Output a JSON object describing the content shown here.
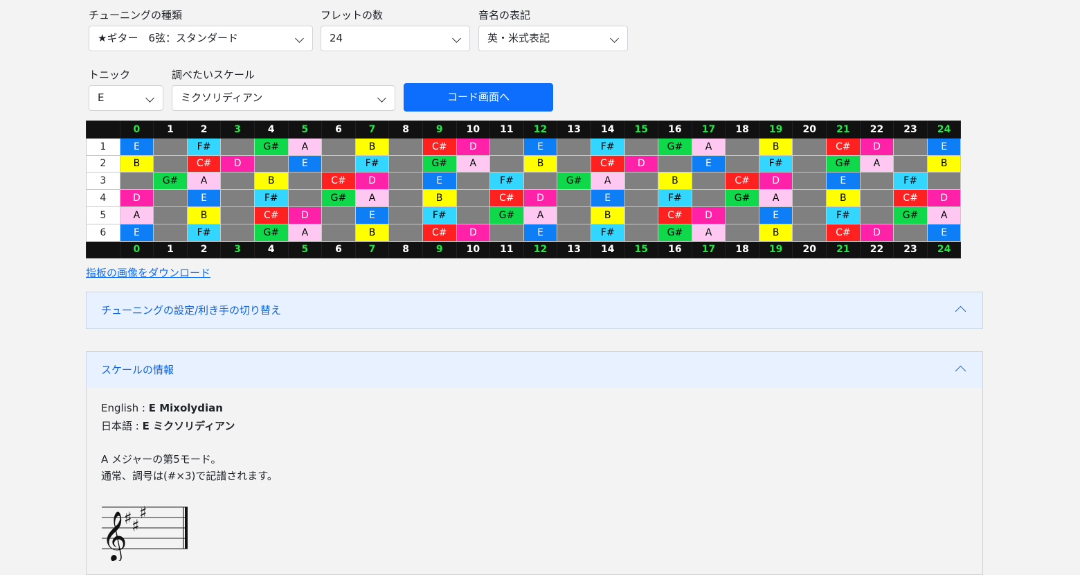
{
  "controls": {
    "tuning_label": "チューニングの種類",
    "tuning_value": "★ギター　6弦：スタンダード",
    "frets_label": "フレットの数",
    "frets_value": "24",
    "notation_label": "音名の表記",
    "notation_value": "英・米式表記",
    "tonic_label": "トニック",
    "tonic_value": "E",
    "scale_label": "調べたいスケール",
    "scale_value": "ミクソリディアン",
    "chord_button": "コード画面へ"
  },
  "fretboard": {
    "fret_numbers": [
      "0",
      "1",
      "2",
      "3",
      "4",
      "5",
      "6",
      "7",
      "8",
      "9",
      "10",
      "11",
      "12",
      "13",
      "14",
      "15",
      "16",
      "17",
      "18",
      "19",
      "20",
      "21",
      "22",
      "23",
      "24"
    ],
    "highlight_frets": [
      "0",
      "3",
      "5",
      "7",
      "9",
      "12",
      "15",
      "17",
      "19",
      "21",
      "24"
    ],
    "strings": [
      {
        "label": "1",
        "notes": [
          "E",
          "",
          "F#",
          "",
          "G#",
          "A",
          "",
          "B",
          "",
          "C#",
          "D",
          "",
          "E",
          "",
          "F#",
          "",
          "G#",
          "A",
          "",
          "B",
          "",
          "C#",
          "D",
          "",
          "E"
        ]
      },
      {
        "label": "2",
        "notes": [
          "B",
          "",
          "C#",
          "D",
          "",
          "E",
          "",
          "F#",
          "",
          "G#",
          "A",
          "",
          "B",
          "",
          "C#",
          "D",
          "",
          "E",
          "",
          "F#",
          "",
          "G#",
          "A",
          "",
          "B"
        ]
      },
      {
        "label": "3",
        "notes": [
          "",
          "G#",
          "A",
          "",
          "B",
          "",
          "C#",
          "D",
          "",
          "E",
          "",
          "F#",
          "",
          "G#",
          "A",
          "",
          "B",
          "",
          "C#",
          "D",
          "",
          "E",
          "",
          "F#",
          ""
        ]
      },
      {
        "label": "4",
        "notes": [
          "D",
          "",
          "E",
          "",
          "F#",
          "",
          "G#",
          "A",
          "",
          "B",
          "",
          "C#",
          "D",
          "",
          "E",
          "",
          "F#",
          "",
          "G#",
          "A",
          "",
          "B",
          "",
          "C#",
          "D"
        ]
      },
      {
        "label": "5",
        "notes": [
          "A",
          "",
          "B",
          "",
          "C#",
          "D",
          "",
          "E",
          "",
          "F#",
          "",
          "G#",
          "A",
          "",
          "B",
          "",
          "C#",
          "D",
          "",
          "E",
          "",
          "F#",
          "",
          "G#",
          "A"
        ]
      },
      {
        "label": "6",
        "notes": [
          "E",
          "",
          "F#",
          "",
          "G#",
          "A",
          "",
          "B",
          "",
          "C#",
          "D",
          "",
          "E",
          "",
          "F#",
          "",
          "G#",
          "A",
          "",
          "B",
          "",
          "C#",
          "D",
          "",
          "E"
        ]
      }
    ],
    "note_colors": {
      "E": "#0d7ef5",
      "F#": "#33d6ff",
      "G#": "#0fd94a",
      "A": "#ffc8f2",
      "B": "#ffff00",
      "C#": "#ff2020",
      "D": "#ff22a9"
    }
  },
  "download_link": "指板の画像をダウンロード",
  "accordion": {
    "tuning_header": "チューニングの設定/利き手の切り替え",
    "scale_header": "スケールの情報"
  },
  "scale_info": {
    "english_label": "English : ",
    "english_value": "E Mixolydian",
    "japanese_label": "日本語 : ",
    "japanese_value": "E ミクソリディアン",
    "description_1": "A メジャーの第5モード。",
    "description_2": "通常、調号は(#×3)で記譜されます。",
    "key_signature_sharps": 3
  }
}
